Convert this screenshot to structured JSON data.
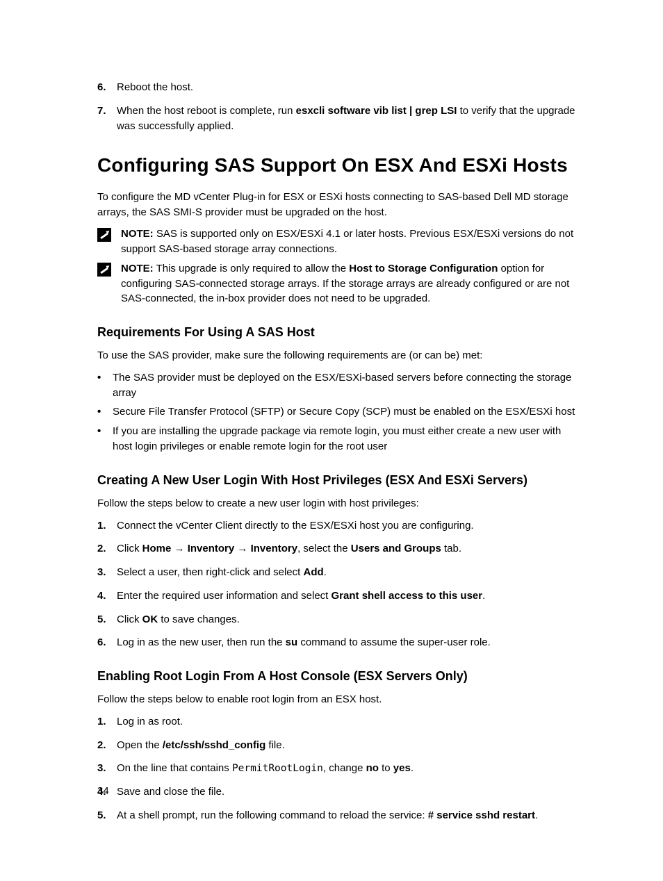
{
  "top_steps": {
    "s6": {
      "num": "6.",
      "text": "Reboot the host."
    },
    "s7": {
      "num": "7.",
      "pre": "When the host reboot is complete, run ",
      "cmd": "esxcli software vib list | grep LSI",
      "post": " to verify that the upgrade was successfully applied."
    }
  },
  "h1": "Configuring SAS Support On ESX And ESXi Hosts",
  "intro": "To configure the MD vCenter Plug-in for ESX or ESXi hosts connecting to SAS-based Dell MD storage arrays, the SAS SMI-S provider must be upgraded on the host.",
  "note1": {
    "label": "NOTE:",
    "text": " SAS is supported only on ESX/ESXi 4.1 or later hosts. Previous ESX/ESXi versions do not support SAS-based storage array connections."
  },
  "note2": {
    "label": "NOTE:",
    "pre": " This upgrade is only required to allow the ",
    "bold": "Host to Storage Configuration",
    "post": " option for configuring SAS-connected storage arrays. If the storage arrays are already configured or are not SAS-connected, the in-box provider does not need to be upgraded."
  },
  "req": {
    "heading": "Requirements For Using A SAS Host",
    "intro": "To use the SAS provider, make sure the following requirements are (or can be) met:",
    "items": [
      "The SAS provider must be deployed on the ESX/ESXi-based servers before connecting the storage array",
      "Secure File Transfer Protocol (SFTP) or Secure Copy (SCP) must be enabled on the ESX/ESXi host",
      "If you are installing the upgrade package via remote login, you must either create a new user with host login privileges or enable remote login for the root user"
    ]
  },
  "create": {
    "heading": "Creating A New User Login With Host Privileges (ESX And ESXi Servers)",
    "intro": "Follow the steps below to create a new user login with host privileges:",
    "s1": {
      "num": "1.",
      "text": "Connect the vCenter Client directly to the ESX/ESXi host you are configuring."
    },
    "s2": {
      "num": "2.",
      "pre": "Click ",
      "b1": "Home",
      "arrow1": " → ",
      "b2": "Inventory",
      "arrow2": " → ",
      "b3": "Inventory",
      "mid": ", select the ",
      "b4": "Users and Groups",
      "post": " tab."
    },
    "s3": {
      "num": "3.",
      "pre": "Select a user, then right-click and select ",
      "b": "Add",
      "post": "."
    },
    "s4": {
      "num": "4.",
      "pre": "Enter the required user information and select ",
      "b": "Grant shell access to this user",
      "post": "."
    },
    "s5": {
      "num": "5.",
      "pre": "Click ",
      "b": "OK",
      "post": " to save changes."
    },
    "s6": {
      "num": "6.",
      "pre": "Log in as the new user, then run the ",
      "b": "su",
      "post": " command to assume the super-user role."
    }
  },
  "root": {
    "heading": "Enabling Root Login From A Host Console (ESX Servers Only)",
    "intro": "Follow the steps below to enable root login from an ESX host.",
    "s1": {
      "num": "1.",
      "text": "Log in as root."
    },
    "s2": {
      "num": "2.",
      "pre": "Open the ",
      "b": "/etc/ssh/sshd_config",
      "post": " file."
    },
    "s3": {
      "num": "3.",
      "pre": "On the line that contains ",
      "mono": "PermitRootLogin",
      "mid": ", change ",
      "b1": "no",
      "to": " to ",
      "b2": "yes",
      "post": "."
    },
    "s4": {
      "num": "4.",
      "text": "Save and close the file."
    },
    "s5": {
      "num": "5.",
      "pre": "At a shell prompt, run the following command to reload the service: ",
      "b": "# service sshd restart",
      "post": "."
    }
  },
  "pagenum": "34"
}
